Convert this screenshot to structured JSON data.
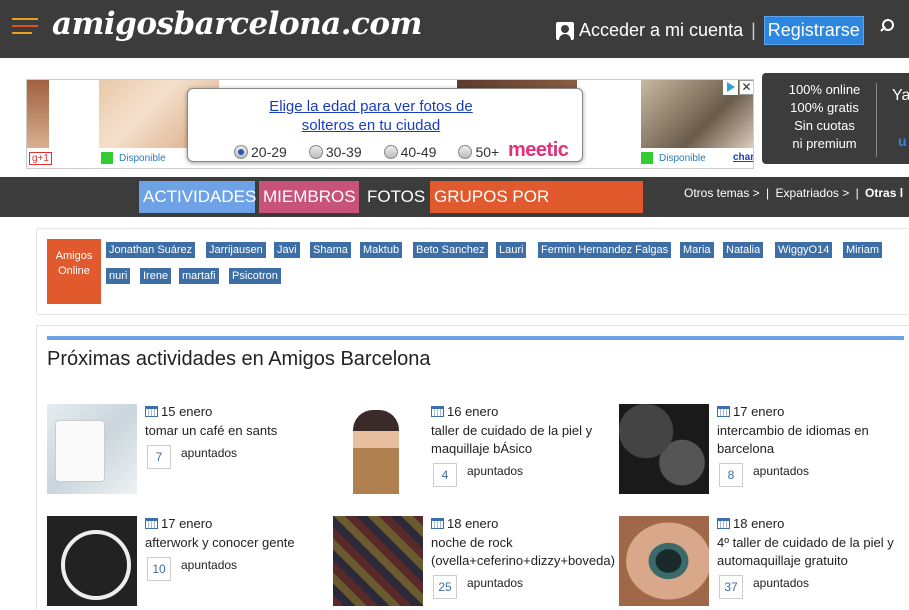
{
  "header": {
    "logo": "amigosbarcelona.com",
    "account_label": "Acceder a mi cuenta",
    "separator": "|",
    "register_label": "Registrarse"
  },
  "ad": {
    "headline": "Elige la edad para ver fotos de solteros en tu ciudad",
    "options": [
      "20-29",
      "30-39",
      "40-49",
      "50+"
    ],
    "selected_option": "20-29",
    "brand": "meetic",
    "status_left": "Disponible",
    "status_right": "Disponible",
    "gplus": "g+1",
    "close": "✕",
    "cut_text_right": "charl"
  },
  "promo": {
    "lines": [
      "100% online",
      "100% gratis",
      "Sin cuotas",
      "ni premium"
    ],
    "cut_top": "Ya",
    "cut_bottom": "u"
  },
  "nav": {
    "tabs": [
      "ACTIVIDADES",
      "MIEMBROS",
      "FOTOS",
      "GRUPOS POR AFICIONES"
    ],
    "links": [
      "Otros temas >",
      "Expatriados >",
      "Otras l"
    ]
  },
  "online": {
    "label": "Amigos Online",
    "users": [
      "Jonathan Suárez",
      "Jarrijausen",
      "Javi",
      "Shama",
      "Maktub",
      "Beto Sanchez",
      "Lauri",
      "Fermin Hernandez Falgas",
      "Maria",
      "Natalia",
      "WiggyO14",
      "Miriam",
      "nuri",
      "Irene",
      "martafi",
      "Psicotron"
    ]
  },
  "activities": {
    "title": "Próximas actividades en Amigos Barcelona",
    "count_label": "apuntados",
    "items": [
      {
        "date": "15 enero",
        "name": "tomar un café en sants",
        "count": "7"
      },
      {
        "date": "16 enero",
        "name": "taller de cuidado de la piel y maquillaje bÁsico",
        "count": "4"
      },
      {
        "date": "17 enero",
        "name": "intercambio de idiomas en barcelona",
        "count": "8"
      },
      {
        "date": "17 enero",
        "name": "afterwork y conocer gente",
        "count": "10"
      },
      {
        "date": "18 enero",
        "name": "noche de rock (ovella+ceferino+dizzy+boveda)",
        "count": "25"
      },
      {
        "date": "18 enero",
        "name": "4º taller de cuidado de la piel y automaquillaje gratuito",
        "count": "37"
      }
    ]
  }
}
